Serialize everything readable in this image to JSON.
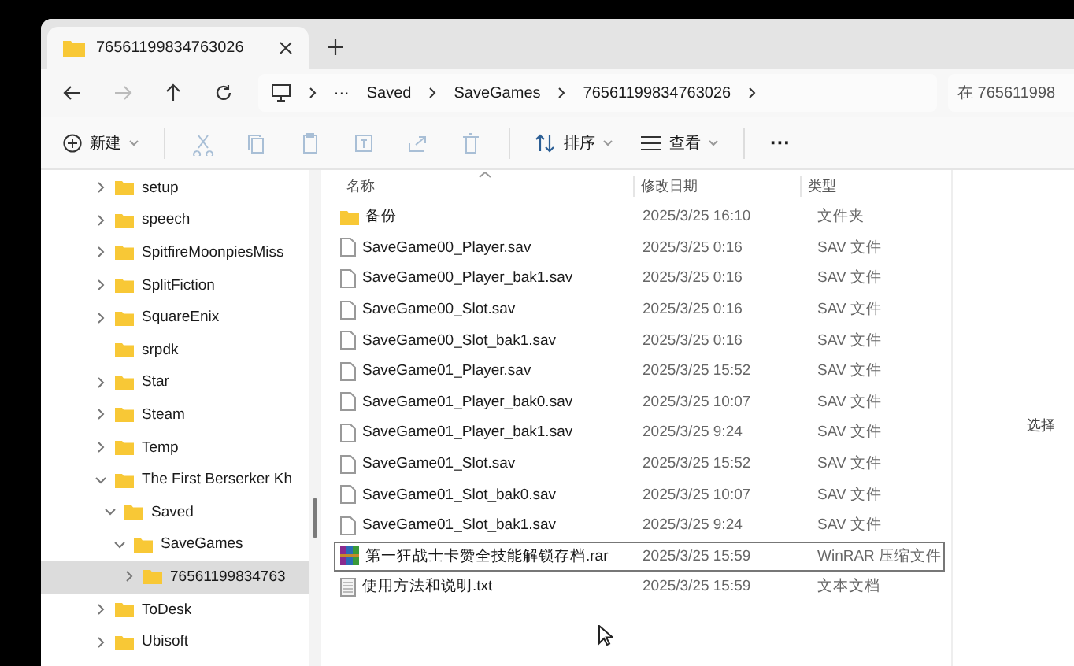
{
  "tabs": [
    {
      "title": "76561199834763026",
      "selected": true
    }
  ],
  "navigation": {
    "back_disabled": false,
    "forward_disabled": true
  },
  "address": {
    "overflow": "···",
    "crumbs": [
      "Saved",
      "SaveGames",
      "76561199834763026"
    ]
  },
  "search": {
    "placeholder": "在 765611998"
  },
  "toolbar": {
    "new_label": "新建",
    "actions": [
      {
        "kind": "cut",
        "disabled": true
      },
      {
        "kind": "copy",
        "disabled": true
      },
      {
        "kind": "paste",
        "disabled": true
      },
      {
        "kind": "rename",
        "disabled": true
      },
      {
        "kind": "share",
        "disabled": true
      },
      {
        "kind": "delete",
        "disabled": true
      }
    ],
    "sort_label": "排序",
    "view_label": "查看",
    "more": "···"
  },
  "sidebar": {
    "items": [
      {
        "label": "setup",
        "expandable": true,
        "expanded": false,
        "selected": false
      },
      {
        "label": "speech",
        "expandable": true,
        "expanded": false,
        "selected": false
      },
      {
        "label": "SpitfireMoonpiesMiss",
        "expandable": true,
        "expanded": false,
        "selected": false
      },
      {
        "label": "SplitFiction",
        "expandable": true,
        "expanded": false,
        "selected": false
      },
      {
        "label": "SquareEnix",
        "expandable": true,
        "expanded": false,
        "selected": false
      },
      {
        "label": "srpdk",
        "expandable": false,
        "selected": false
      },
      {
        "label": "Star",
        "expandable": true,
        "expanded": false,
        "selected": false
      },
      {
        "label": "Steam",
        "expandable": true,
        "expanded": false,
        "selected": false
      },
      {
        "label": "Temp",
        "expandable": true,
        "expanded": false,
        "selected": false
      },
      {
        "label": "The First Berserker Kh",
        "expandable": true,
        "expanded": true,
        "selected": false,
        "children": [
          {
            "label": "Saved",
            "expandable": true,
            "expanded": true,
            "selected": false,
            "children": [
              {
                "label": "SaveGames",
                "expandable": true,
                "expanded": true,
                "selected": false,
                "children": [
                  {
                    "label": "76561199834763",
                    "expandable": true,
                    "expanded": false,
                    "selected": true
                  }
                ]
              }
            ]
          }
        ]
      },
      {
        "label": "ToDesk",
        "expandable": true,
        "expanded": false,
        "selected": false
      },
      {
        "label": "Ubisoft",
        "expandable": true,
        "expanded": false,
        "selected": false
      }
    ]
  },
  "table": {
    "columns": [
      "名称",
      "修改日期",
      "类型"
    ],
    "rows": [
      {
        "kind": "folder",
        "name": "备份",
        "date": "2025/3/25 16:10",
        "type": "文件夹",
        "focused": false
      },
      {
        "kind": "file",
        "name": "SaveGame00_Player.sav",
        "date": "2025/3/25 0:16",
        "type": "SAV 文件",
        "focused": false
      },
      {
        "kind": "file",
        "name": "SaveGame00_Player_bak1.sav",
        "date": "2025/3/25 0:16",
        "type": "SAV 文件",
        "focused": false
      },
      {
        "kind": "file",
        "name": "SaveGame00_Slot.sav",
        "date": "2025/3/25 0:16",
        "type": "SAV 文件",
        "focused": false
      },
      {
        "kind": "file",
        "name": "SaveGame00_Slot_bak1.sav",
        "date": "2025/3/25 0:16",
        "type": "SAV 文件",
        "focused": false
      },
      {
        "kind": "file",
        "name": "SaveGame01_Player.sav",
        "date": "2025/3/25 15:52",
        "type": "SAV 文件",
        "focused": false
      },
      {
        "kind": "file",
        "name": "SaveGame01_Player_bak0.sav",
        "date": "2025/3/25 10:07",
        "type": "SAV 文件",
        "focused": false
      },
      {
        "kind": "file",
        "name": "SaveGame01_Player_bak1.sav",
        "date": "2025/3/25 9:24",
        "type": "SAV 文件",
        "focused": false
      },
      {
        "kind": "file",
        "name": "SaveGame01_Slot.sav",
        "date": "2025/3/25 15:52",
        "type": "SAV 文件",
        "focused": false
      },
      {
        "kind": "file",
        "name": "SaveGame01_Slot_bak0.sav",
        "date": "2025/3/25 10:07",
        "type": "SAV 文件",
        "focused": false
      },
      {
        "kind": "file",
        "name": "SaveGame01_Slot_bak1.sav",
        "date": "2025/3/25 9:24",
        "type": "SAV 文件",
        "focused": false
      },
      {
        "kind": "archive",
        "name": "第一狂战士卡赞全技能解锁存档.rar",
        "date": "2025/3/25 15:59",
        "type": "WinRAR 压缩文件",
        "focused": true
      },
      {
        "kind": "text",
        "name": "使用方法和说明.txt",
        "date": "2025/3/25 15:59",
        "type": "文本文档",
        "focused": false
      }
    ]
  },
  "details_pane": {
    "text": "选择"
  }
}
